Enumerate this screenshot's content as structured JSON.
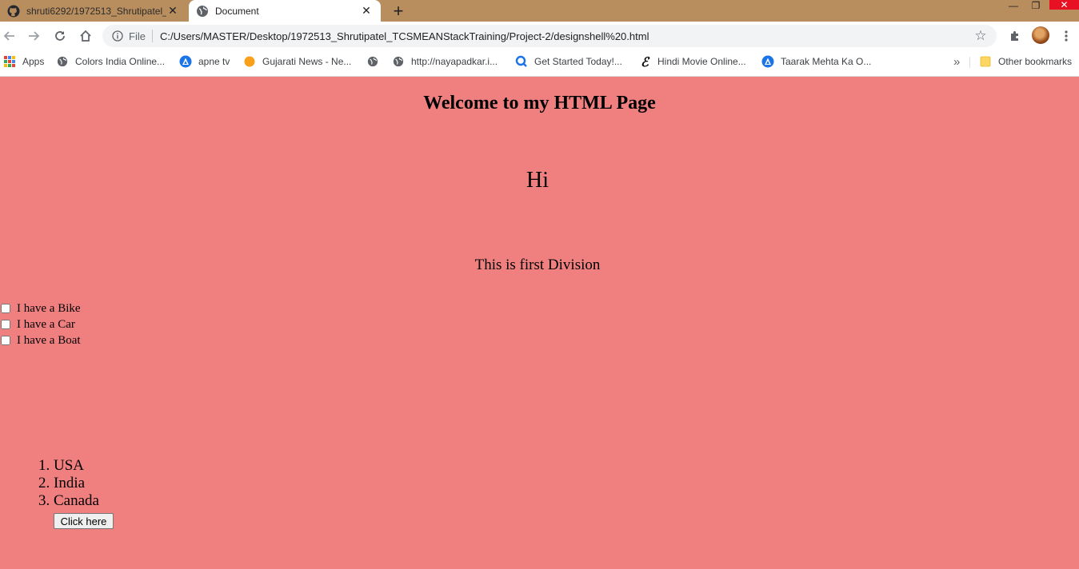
{
  "browser": {
    "tabs": [
      {
        "title": "shruti6292/1972513_Shrutipatel_",
        "icon": "github-icon",
        "active": false
      },
      {
        "title": "Document",
        "icon": "globe-icon",
        "active": true
      }
    ],
    "new_tab_symbol": "+",
    "omnibox": {
      "scheme_label": "File",
      "url": "C:/Users/MASTER/Desktop/1972513_Shrutipatel_TCSMEANStackTraining/Project-2/designshell%20.html"
    },
    "bookmarks": [
      {
        "label": "Apps",
        "icon": "apps-grid-icon"
      },
      {
        "label": "Colors India Online...",
        "icon": "globe-icon"
      },
      {
        "label": "apne tv",
        "icon": "triangle-logo-icon"
      },
      {
        "label": "Gujarati News - Ne...",
        "icon": "orange-circle-icon"
      },
      {
        "label": "",
        "icon": "globe-icon"
      },
      {
        "label": "http://nayapadkar.i...",
        "icon": "globe-icon"
      },
      {
        "label": "Get Started Today!...",
        "icon": "search-q-icon"
      },
      {
        "label": "Hindi Movie Online...",
        "icon": "script-e-icon"
      },
      {
        "label": "Taarak Mehta Ka O...",
        "icon": "triangle-logo-icon"
      }
    ],
    "overflow_symbol": "»",
    "other_bookmarks_label": "Other bookmarks",
    "colors": {
      "tab_strip": "#b98e5f",
      "page_background": "#f08080"
    }
  },
  "page": {
    "heading": "Welcome to my HTML Page",
    "greeting": "Hi",
    "division_text": "This is first Division",
    "checkboxes": [
      {
        "label": "I have a Bike",
        "checked": false
      },
      {
        "label": "I have a Car",
        "checked": false
      },
      {
        "label": "I have a Boat",
        "checked": false
      }
    ],
    "countries": [
      "USA",
      "India",
      "Canada"
    ],
    "button_label": "Click here"
  }
}
